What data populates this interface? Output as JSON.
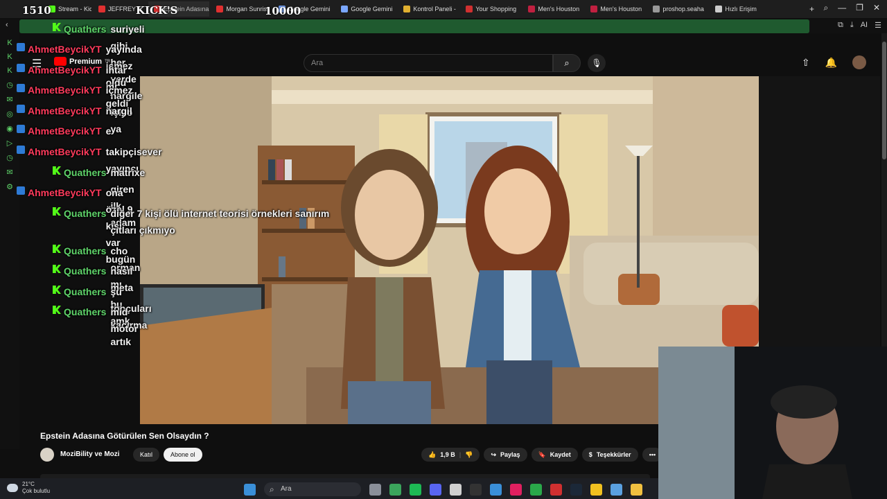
{
  "overlay": {
    "counter_left": "1510",
    "counter_kick": "KICK'S",
    "counter_mid": "10000"
  },
  "browser": {
    "tabs": [
      {
        "label": "Stream - Kick D",
        "color": "#53fc18",
        "active": false
      },
      {
        "label": "JEFFREY E",
        "color": "#e03030",
        "active": false
      },
      {
        "label": "Epstein Adasına Götürüle",
        "color": "#e03030",
        "active": true
      },
      {
        "label": "Morgan Sunris",
        "color": "#e03030",
        "active": false
      },
      {
        "label": "Google Gemini",
        "color": "#7aa7ff",
        "active": false
      },
      {
        "label": "Google Gemini",
        "color": "#7aa7ff",
        "active": false
      },
      {
        "label": "Kontrol Paneli -",
        "color": "#e0b030",
        "active": false
      },
      {
        "label": "Your Shopping",
        "color": "#d03030",
        "active": false
      },
      {
        "label": "Men's Houston",
        "color": "#c02040",
        "active": false
      },
      {
        "label": "Men's Houston",
        "color": "#c02040",
        "active": false
      },
      {
        "label": "proshop.seaha",
        "color": "#999999",
        "active": false
      },
      {
        "label": "Hızlı Erişim",
        "color": "#cccccc",
        "active": false
      }
    ],
    "new_tab": "+",
    "win_controls": [
      "⌕",
      "—",
      "❐",
      "✕"
    ],
    "addr_ai": "AI"
  },
  "chat": [
    {
      "badge": "kick",
      "user": "Quathers",
      "color": "#5fd46a",
      "text": "suriyeli gibi her yerde nargile içiyo ya"
    },
    {
      "badge": "mod",
      "user": "AhmetBeycikYT",
      "color": "#ff3b5c",
      "text": "yayında işmez oldu"
    },
    {
      "badge": "mod",
      "user": "AhmetBeycikYT",
      "color": "#ff3b5c",
      "text": "ihtar mı geldi"
    },
    {
      "badge": "mod",
      "user": "AhmetBeycikYT",
      "color": "#ff3b5c",
      "text": "içmez"
    },
    {
      "badge": "mod",
      "user": "AhmetBeycikYT",
      "color": "#ff3b5c",
      "text": "nargil"
    },
    {
      "badge": "mod",
      "user": "AhmetBeycikYT",
      "color": "#ff3b5c",
      "text": "e"
    },
    {
      "badge": "mod",
      "user": "AhmetBeycikYT",
      "color": "#ff3b5c",
      "text": "takipçisever yayıncı"
    },
    {
      "badge": "kick",
      "user": "Quathers",
      "color": "#5fd46a",
      "text": "matrixe giren ilk adam"
    },
    {
      "badge": "mod",
      "user": "AhmetBeycikYT",
      "color": "#ff3b5c",
      "text": "ona özel 9 kişi var bugün"
    },
    {
      "badge": "kick",
      "user": "Quathers",
      "color": "#5fd46a",
      "text": "diğer 7 kişi ölü internet teorisi örnekleri sanırım çıtları çıkmıyo"
    },
    {
      "badge": "kick",
      "user": "Quathers",
      "color": "#5fd46a",
      "text": "cho orman mı"
    },
    {
      "badge": "kick",
      "user": "Quathers",
      "color": "#5fd46a",
      "text": "nasıl meta bu amk"
    },
    {
      "badge": "kick",
      "user": "Quathers",
      "color": "#5fd46a",
      "text": "şu topçuları kaçırma artık"
    },
    {
      "badge": "kick",
      "user": "Quathers",
      "color": "#5fd46a",
      "text": "mid motor"
    }
  ],
  "youtube": {
    "logo_text": "Premium",
    "logo_sup": "TR",
    "search_placeholder": "Ara",
    "video_title": "Epstein Adasına Götürülen Sen Olsaydın ?",
    "channel_name": "MoziBility ve Mozi",
    "join_label": "Katıl",
    "subscribe_label": "Abone ol",
    "likes": "1,9 B",
    "share_label": "Paylaş",
    "save_label": "Kaydet",
    "thanks_label": "Teşekkürler",
    "more_label": "•••"
  },
  "taskbar": {
    "temperature": "21°C",
    "weather_text": "Çok bulutlu",
    "search_text": "Ara",
    "icons": [
      {
        "name": "task-view-icon",
        "color": "#8a8f99"
      },
      {
        "name": "chrome-icon",
        "color": "#3ba55c"
      },
      {
        "name": "spotify-icon",
        "color": "#1db954"
      },
      {
        "name": "discord-icon",
        "color": "#5865f2"
      },
      {
        "name": "store-icon",
        "color": "#d0d0d0"
      },
      {
        "name": "epic-icon",
        "color": "#333333"
      },
      {
        "name": "photos-icon",
        "color": "#3a8fd8"
      },
      {
        "name": "obs-icon",
        "color": "#e02060"
      },
      {
        "name": "xbox-icon",
        "color": "#2aa84a"
      },
      {
        "name": "record-icon",
        "color": "#d03030"
      },
      {
        "name": "steam-icon",
        "color": "#1b2838"
      },
      {
        "name": "note-icon",
        "color": "#f0c020"
      },
      {
        "name": "network-icon",
        "color": "#5aa0e0"
      },
      {
        "name": "folder-icon",
        "color": "#f0c040"
      }
    ]
  }
}
